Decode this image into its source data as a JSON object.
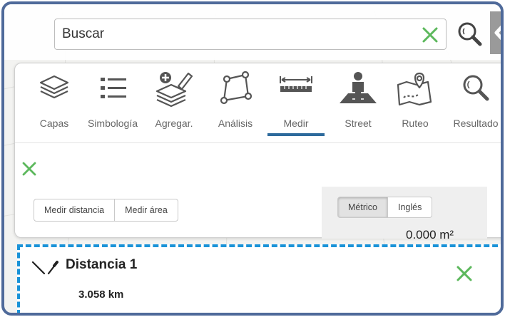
{
  "search": {
    "placeholder": "Buscar"
  },
  "toolbar": {
    "tools": [
      {
        "id": "capas",
        "label": "Capas",
        "icon": "layers-icon"
      },
      {
        "id": "simbologia",
        "label": "Simbología",
        "icon": "list-icon"
      },
      {
        "id": "agregar",
        "label": "Agregar.",
        "icon": "add-layer-icon"
      },
      {
        "id": "analisis",
        "label": "Análisis",
        "icon": "polygon-icon"
      },
      {
        "id": "medir",
        "label": "Medir",
        "icon": "ruler-icon",
        "active": true
      },
      {
        "id": "street",
        "label": "Street",
        "icon": "street-view-icon"
      },
      {
        "id": "ruteo",
        "label": "Ruteo",
        "icon": "route-icon"
      },
      {
        "id": "resultado",
        "label": "Resultado",
        "icon": "search-icon"
      }
    ]
  },
  "measure_panel": {
    "distance_button": "Medir distancia",
    "area_button": "Medir área",
    "units": {
      "metric": "Métrico",
      "imperial": "Inglés",
      "selected": "Métrico"
    },
    "result": "0.000 m²"
  },
  "measurement": {
    "title": "Distancia 1",
    "value": "3.058 km"
  },
  "colors": {
    "frame_border": "#4f6a9a",
    "accent": "#2d6a9c",
    "close_green": "#5cb85c",
    "dashed_border": "#1a93d8"
  }
}
